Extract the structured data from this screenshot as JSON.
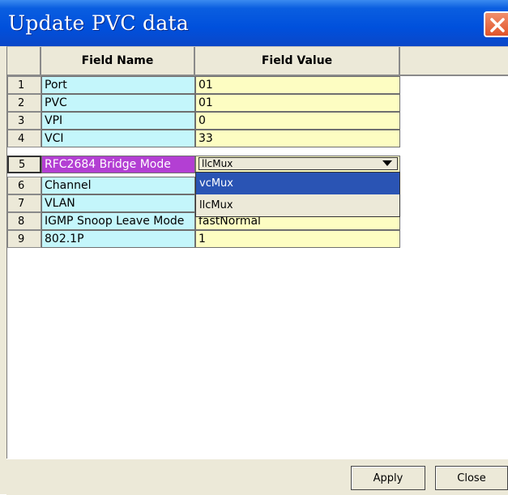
{
  "window": {
    "title": "Update PVC data"
  },
  "table": {
    "headers": {
      "name": "Field Name",
      "value": "Field Value"
    },
    "rows": [
      {
        "num": "1",
        "name": "Port",
        "value": "01"
      },
      {
        "num": "2",
        "name": "PVC",
        "value": "01"
      },
      {
        "num": "3",
        "name": "VPI",
        "value": "0"
      },
      {
        "num": "4",
        "name": "VCI",
        "value": "33"
      },
      {
        "num": "5",
        "name": "RFC2684 Bridge Mode",
        "value": "llcMux"
      },
      {
        "num": "6",
        "name": "Channel",
        "value": ""
      },
      {
        "num": "7",
        "name": "VLAN",
        "value": ""
      },
      {
        "num": "8",
        "name": "IGMP Snoop Leave Mode",
        "value": "fastNormal"
      },
      {
        "num": "9",
        "name": "802.1P",
        "value": "1"
      }
    ]
  },
  "dropdown": {
    "options": [
      "vcMux",
      "llcMux"
    ],
    "highlighted": "vcMux"
  },
  "buttons": {
    "apply": "Apply",
    "close": "Close"
  },
  "colors": {
    "title_bar": "#0050dc",
    "name_cell": "#c4f6fb",
    "value_cell": "#fdfdc2",
    "selected_cell": "#b33fd3",
    "highlight": "#2a54b4"
  }
}
